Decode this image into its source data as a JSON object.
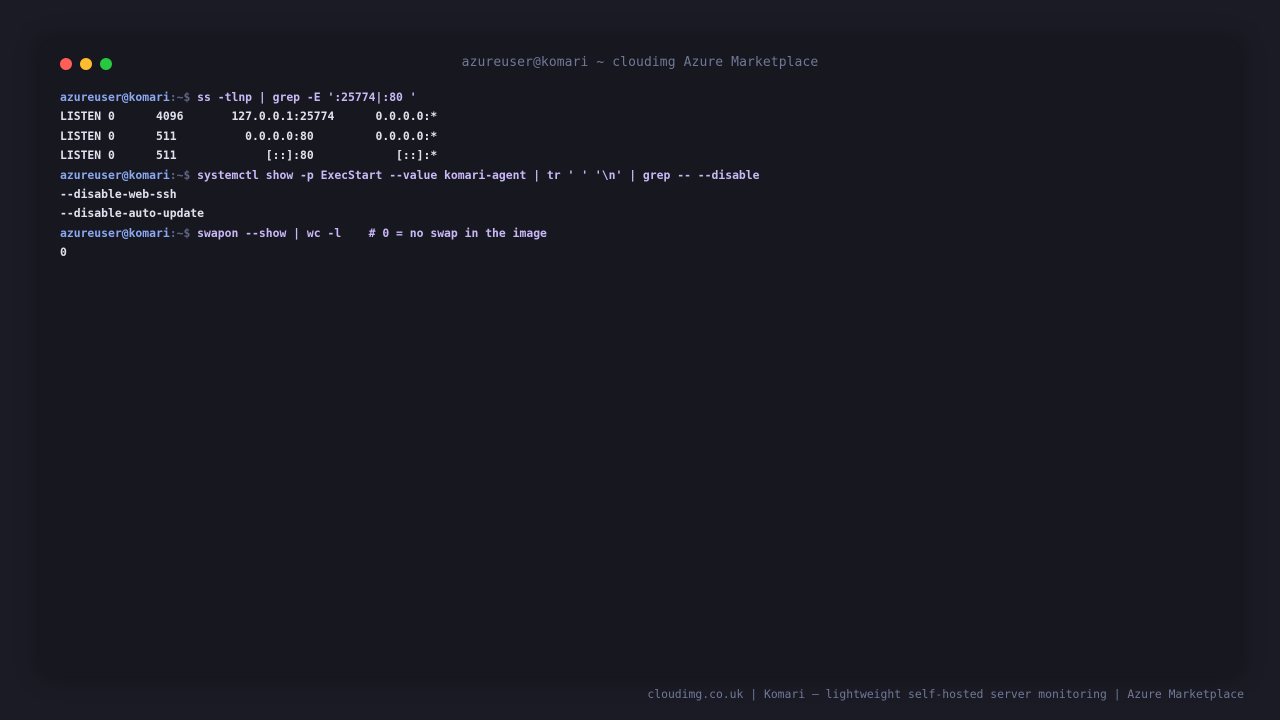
{
  "window": {
    "title": "azureuser@komari ~ cloudimg Azure Marketplace",
    "buttons": {
      "close_color": "#ff5f57",
      "minimize_color": "#febc2e",
      "maximize_color": "#28c840"
    }
  },
  "prompt": {
    "user_host": "azureuser@komari",
    "path": ":~$ "
  },
  "terminal": {
    "cmd1": "ss -tlnp | grep -E ':25774|:80 '",
    "out1": [
      "LISTEN 0      4096       127.0.0.1:25774      0.0.0.0:*",
      "LISTEN 0      511          0.0.0.0:80         0.0.0.0:*",
      "LISTEN 0      511             [::]:80            [::]:*"
    ],
    "cmd2": "systemctl show -p ExecStart --value komari-agent | tr ' ' '\\n' | grep -- --disable",
    "out2": [
      "--disable-web-ssh",
      "--disable-auto-update"
    ],
    "cmd3": "swapon --show | wc -l    # 0 = no swap in the image",
    "out3": [
      "0"
    ]
  },
  "footer": {
    "text": "cloudimg.co.uk | Komari — lightweight self-hosted server monitoring | Azure Marketplace"
  }
}
